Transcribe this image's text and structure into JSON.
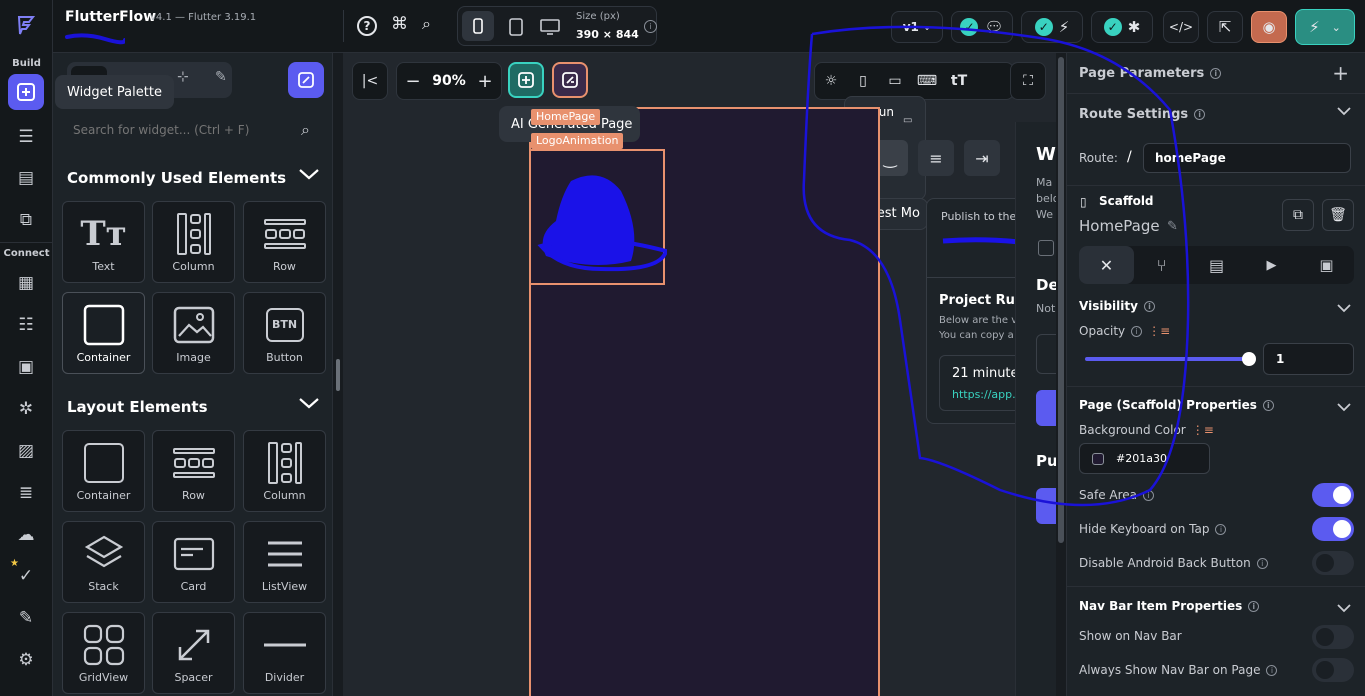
{
  "app": {
    "name": "FlutterFlow",
    "version": "v4.1 — Flutter 3.19.1"
  },
  "rail": {
    "build_label": "Build",
    "connect_label": "Connect"
  },
  "tooltip": "Widget Palette",
  "topbar": {
    "size_label": "Size (px)",
    "size_value": "390 × 844",
    "version_btn": "v1"
  },
  "left": {
    "search_placeholder": "Search for widget... (Ctrl + F)",
    "common_title": "Commonly Used Elements",
    "common_tiles": [
      "Text",
      "Column",
      "Row",
      "Container",
      "Image",
      "Button"
    ],
    "layout_title": "Layout Elements",
    "layout_tiles": [
      "Container",
      "Row",
      "Column",
      "Stack",
      "Card",
      "ListView",
      "GridView",
      "Spacer",
      "Divider"
    ],
    "btn_icon_text": "BTN"
  },
  "canvas": {
    "zoom": "90%",
    "ai_tooltip": "AI Generated Page",
    "tag_page": "HomePage",
    "tag_logo": "LogoAnimation",
    "run_label": "Run",
    "test_label": "Test Mo",
    "publish_text": "Publish to the",
    "project_run_title": "Project Run",
    "project_run_line1": "Below are the v",
    "project_run_line2": "You can copy a",
    "minutes": "21 minutes",
    "app_link": "https://app.f",
    "side_w": "W",
    "side_ma": "Ma",
    "side_bel": "belo",
    "side_we": "We",
    "side_de": "De",
    "side_not": "Not",
    "side_pu": "Pu"
  },
  "right": {
    "page_params": "Page Parameters",
    "route_settings": "Route Settings",
    "route_label": "Route:",
    "route_slash": "/",
    "route_value": "homePage",
    "scaffold": "Scaffold",
    "page_name": "HomePage",
    "visibility": "Visibility",
    "opacity": "Opacity",
    "opacity_value": "1",
    "scaffold_props": "Page (Scaffold) Properties",
    "bg_color_label": "Background Color",
    "bg_color_value": "#201a30",
    "safe_area": "Safe Area",
    "hide_keyboard": "Hide Keyboard on Tap",
    "disable_back": "Disable Android Back Button",
    "navbar_props": "Nav Bar Item Properties",
    "show_navbar": "Show on Nav Bar",
    "always_navbar": "Always Show Nav Bar on Page"
  },
  "colors": {
    "accent": "#5b5bf0",
    "teal": "#39d2c0",
    "orange": "#e8916e",
    "page_bg": "#201a30"
  }
}
